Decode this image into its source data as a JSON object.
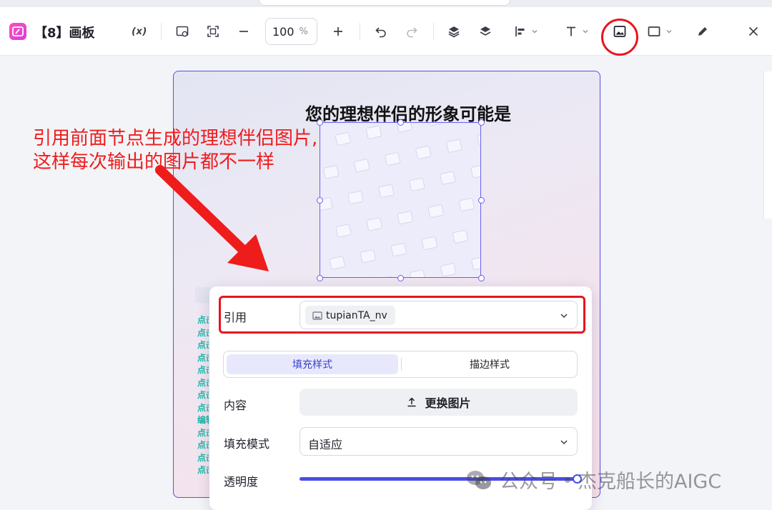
{
  "app": {
    "title": "【8】画板"
  },
  "toolbar": {
    "variable_label": "(x)",
    "zoom": {
      "value": "100",
      "unit": "%"
    }
  },
  "icons": [
    "whiteboard-app-icon",
    "variable-icon",
    "frame-add-icon",
    "fit-screen-icon",
    "zoom-out-icon",
    "zoom-in-icon",
    "undo-icon",
    "redo-icon",
    "bring-front-icon",
    "layers-icon",
    "align-left-icon",
    "text-icon",
    "image-icon",
    "rectangle-icon",
    "pen-icon",
    "close-icon",
    "upload-icon",
    "chevron-down-icon"
  ],
  "canvas": {
    "board_title": "您的理想伴侣的形象可能是",
    "side_labels": [
      "点击",
      "点击",
      "点击",
      "点击",
      "点击",
      "点击",
      "点击",
      "点击",
      "编辑",
      "点击",
      "点击",
      "点击",
      "点击"
    ]
  },
  "annotation": {
    "line1": "引用前面节点生成的理想伴侣图片,",
    "line2": "这样每次输出的图片都不一样",
    "color": "#ef1c1c"
  },
  "panel": {
    "reference": {
      "label": "引用",
      "value": "tupianTA_nv"
    },
    "tabs": [
      "填充样式",
      "描边样式"
    ],
    "active_tab": 0,
    "content": {
      "label": "内容",
      "button": "更换图片"
    },
    "fill_mode": {
      "label": "填充模式",
      "value": "自适应"
    },
    "opacity": {
      "label": "透明度",
      "value": 1.0
    }
  },
  "watermark": {
    "source": "公众号",
    "author": "杰克船长的AIGC"
  },
  "colors": {
    "accent": "#4b4ee6",
    "highlight_red": "#e8141e",
    "teal": "#17b9a8"
  }
}
